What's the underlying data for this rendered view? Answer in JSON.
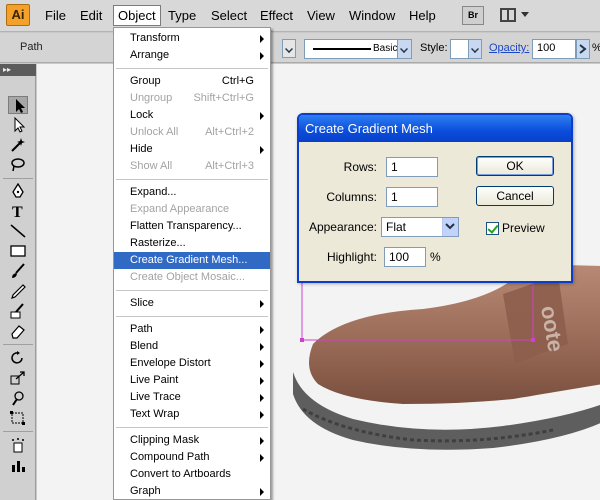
{
  "app": {
    "logo_text": "Ai"
  },
  "menubar": {
    "items": [
      "File",
      "Edit",
      "Object",
      "Type",
      "Select",
      "Effect",
      "View",
      "Window",
      "Help"
    ],
    "bridge_label": "Br"
  },
  "controlbar": {
    "selection_label": "Path",
    "brush_name": "Basic",
    "style_label": "Style:",
    "opacity_label": "Opacity:",
    "opacity_value": "100",
    "opacity_unit": "%"
  },
  "object_menu": {
    "items": [
      {
        "label": "Transform",
        "shortcut": "",
        "submenu": true,
        "disabled": false,
        "highlighted": false
      },
      {
        "label": "Arrange",
        "shortcut": "",
        "submenu": true,
        "disabled": false,
        "highlighted": false
      },
      {
        "label": "Group",
        "shortcut": "Ctrl+G",
        "submenu": false,
        "disabled": false,
        "highlighted": false
      },
      {
        "label": "Ungroup",
        "shortcut": "Shift+Ctrl+G",
        "submenu": false,
        "disabled": true,
        "highlighted": false
      },
      {
        "label": "Lock",
        "shortcut": "",
        "submenu": true,
        "disabled": false,
        "highlighted": false
      },
      {
        "label": "Unlock All",
        "shortcut": "Alt+Ctrl+2",
        "submenu": false,
        "disabled": true,
        "highlighted": false
      },
      {
        "label": "Hide",
        "shortcut": "",
        "submenu": true,
        "disabled": false,
        "highlighted": false
      },
      {
        "label": "Show All",
        "shortcut": "Alt+Ctrl+3",
        "submenu": false,
        "disabled": true,
        "highlighted": false
      },
      {
        "label": "Expand...",
        "shortcut": "",
        "submenu": false,
        "disabled": false,
        "highlighted": false
      },
      {
        "label": "Expand Appearance",
        "shortcut": "",
        "submenu": false,
        "disabled": true,
        "highlighted": false
      },
      {
        "label": "Flatten Transparency...",
        "shortcut": "",
        "submenu": false,
        "disabled": false,
        "highlighted": false
      },
      {
        "label": "Rasterize...",
        "shortcut": "",
        "submenu": false,
        "disabled": false,
        "highlighted": false
      },
      {
        "label": "Create Gradient Mesh...",
        "shortcut": "",
        "submenu": false,
        "disabled": false,
        "highlighted": true
      },
      {
        "label": "Create Object Mosaic...",
        "shortcut": "",
        "submenu": false,
        "disabled": true,
        "highlighted": false
      },
      {
        "label": "Slice",
        "shortcut": "",
        "submenu": true,
        "disabled": false,
        "highlighted": false
      },
      {
        "label": "Path",
        "shortcut": "",
        "submenu": true,
        "disabled": false,
        "highlighted": false
      },
      {
        "label": "Blend",
        "shortcut": "",
        "submenu": true,
        "disabled": false,
        "highlighted": false
      },
      {
        "label": "Envelope Distort",
        "shortcut": "",
        "submenu": true,
        "disabled": false,
        "highlighted": false
      },
      {
        "label": "Live Paint",
        "shortcut": "",
        "submenu": true,
        "disabled": false,
        "highlighted": false
      },
      {
        "label": "Live Trace",
        "shortcut": "",
        "submenu": true,
        "disabled": false,
        "highlighted": false
      },
      {
        "label": "Text Wrap",
        "shortcut": "",
        "submenu": true,
        "disabled": false,
        "highlighted": false
      },
      {
        "label": "Clipping Mask",
        "shortcut": "",
        "submenu": true,
        "disabled": false,
        "highlighted": false
      },
      {
        "label": "Compound Path",
        "shortcut": "",
        "submenu": true,
        "disabled": false,
        "highlighted": false
      },
      {
        "label": "Convert to Artboards",
        "shortcut": "",
        "submenu": false,
        "disabled": false,
        "highlighted": false
      },
      {
        "label": "Graph",
        "shortcut": "",
        "submenu": true,
        "disabled": false,
        "highlighted": false
      }
    ]
  },
  "dialog": {
    "title": "Create Gradient Mesh",
    "rows_label": "Rows:",
    "rows_value": "1",
    "columns_label": "Columns:",
    "columns_value": "1",
    "appearance_label": "Appearance:",
    "appearance_value": "Flat",
    "highlight_label": "Highlight:",
    "highlight_value": "100",
    "highlight_unit": "%",
    "ok_label": "OK",
    "cancel_label": "Cancel",
    "preview_label": "Preview",
    "preview_checked": true
  },
  "colors": {
    "accent": "#316ac5",
    "dialog_title": "#0a4ddb",
    "selection_box": "#d040d0",
    "app_logo": "#f3a12a"
  },
  "icons": [
    "selection-tool-icon",
    "direct-selection-tool-icon",
    "magic-wand-icon",
    "lasso-icon",
    "pen-tool-icon",
    "type-tool-icon",
    "line-tool-icon",
    "rectangle-tool-icon",
    "paintbrush-icon",
    "pencil-icon",
    "blob-brush-icon",
    "eraser-icon",
    "rotate-tool-icon",
    "scale-tool-icon",
    "warp-tool-icon",
    "free-transform-icon",
    "symbol-sprayer-icon",
    "graph-tool-icon"
  ]
}
